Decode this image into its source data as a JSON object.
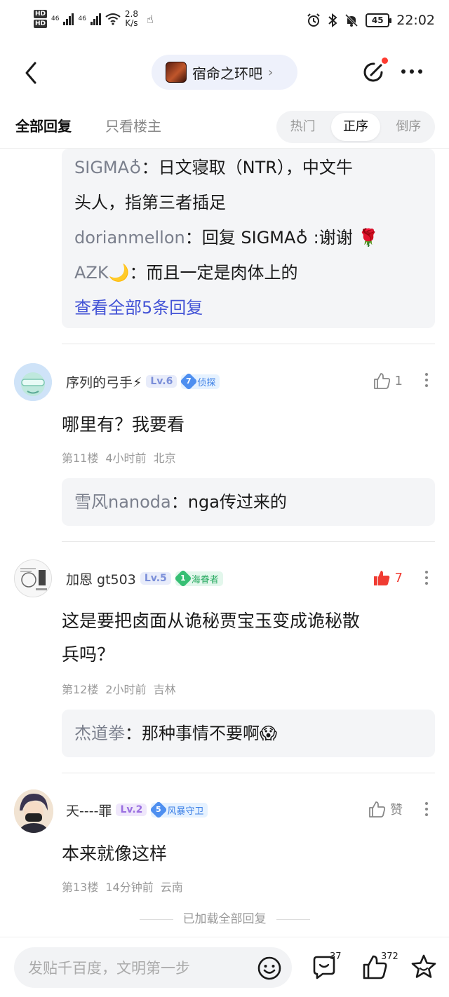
{
  "status_bar": {
    "net_speed": "2.8",
    "net_unit": "K/s",
    "sig1": "46",
    "sig2": "46",
    "hd1": "HD",
    "hd2": "HD",
    "battery": "45",
    "time": "22:02"
  },
  "nav": {
    "forum_name": "宿命之环吧",
    "chevron": "›",
    "back_icon": "back-arrow",
    "edit_icon": "edit-post",
    "more_icon": "more-dots"
  },
  "tabs": {
    "all_replies": "全部回复",
    "owner_only": "只看楼主",
    "sort": [
      "热门",
      "正序",
      "倒序"
    ],
    "active_sort": "正序"
  },
  "top_subreplies": [
    {
      "user": "SIGMA♁",
      "sep": "：",
      "text": "日文寝取（NTR），中文牛",
      "cont": "头人，指第三者插足"
    },
    {
      "user": "dorianmellon",
      "sep": "：",
      "text": "回复 SIGMA♁ :谢谢 🌹"
    },
    {
      "user": "AZK🌙",
      "sep": "：",
      "text": "而且一定是肉体上的"
    }
  ],
  "view_all": "查看全部5条回复",
  "comments": [
    {
      "username": "序列的弓手⚡",
      "level": "Lv.6",
      "badge_num": "7",
      "badge_text": "侦探",
      "likes": "1",
      "text": "哪里有？我要看",
      "floor": "第11楼",
      "time": "4小时前",
      "location": "北京",
      "reply_user": "雪风nanoda",
      "reply_sep": "：",
      "reply_text": "nga传过来的"
    },
    {
      "username": "加恩 gt503",
      "level": "Lv.5",
      "badge_num": "1",
      "badge_text": "海眷者",
      "likes": "7",
      "text": "这是要把卤面从诡秘贾宝玉变成诡秘散",
      "text_cont": "兵吗？",
      "floor": "第12楼",
      "time": "2小时前",
      "location": "吉林",
      "reply_user": "杰道拳",
      "reply_sep": "：",
      "reply_text": "那种事情不要啊😱"
    },
    {
      "username": "天----罪",
      "level": "Lv.2",
      "badge_num": "5",
      "badge_text": "风暴守卫",
      "likes": "赞",
      "text": "本来就像这样",
      "floor": "第13楼",
      "time": "14分钟前",
      "location": "云南"
    }
  ],
  "loaded_text": "已加载全部回复",
  "bottom_bar": {
    "placeholder": "发贴千百度，文明第一步",
    "comment_count": "37",
    "like_count": "372"
  },
  "colors": {
    "accent": "#4353d6",
    "like_active": "#f03c33",
    "subuser": "#7a7f8c"
  }
}
